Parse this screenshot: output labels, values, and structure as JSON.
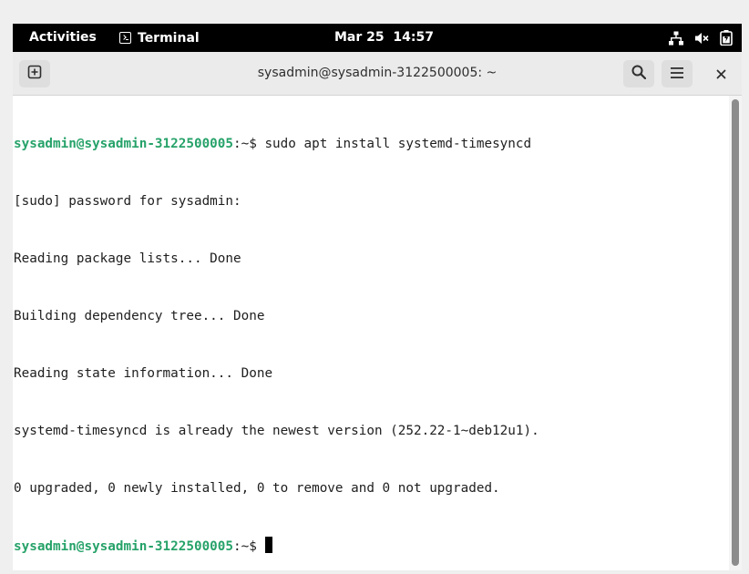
{
  "topbar": {
    "activities": "Activities",
    "app_name": "Terminal",
    "clock": "Mar 25  14:57",
    "tray_icons": [
      "network-icon",
      "volume-muted-icon",
      "battery-icon"
    ]
  },
  "window": {
    "title": "sysadmin@sysadmin-3122500005: ~",
    "buttons": [
      "new-tab-icon",
      "search-icon",
      "hamburger-menu-icon",
      "close-icon"
    ]
  },
  "terminal": {
    "prompt_user": "sysadmin@sysadmin-3122500005",
    "prompt_suffix": ":~$ ",
    "command": "sudo apt install systemd-timesyncd",
    "output": [
      "[sudo] password for sysadmin:",
      "Reading package lists... Done",
      "Building dependency tree... Done",
      "Reading state information... Done",
      "systemd-timesyncd is already the newest version (252.22-1~deb12u1).",
      "0 upgraded, 0 newly installed, 0 to remove and 0 not upgraded."
    ],
    "prompt_user_2": "sysadmin@sysadmin-3122500005",
    "prompt_suffix_2": ":~$ "
  },
  "colors": {
    "prompt_green": "#26a269",
    "topbar": "#000000",
    "header": "#ebebeb"
  }
}
